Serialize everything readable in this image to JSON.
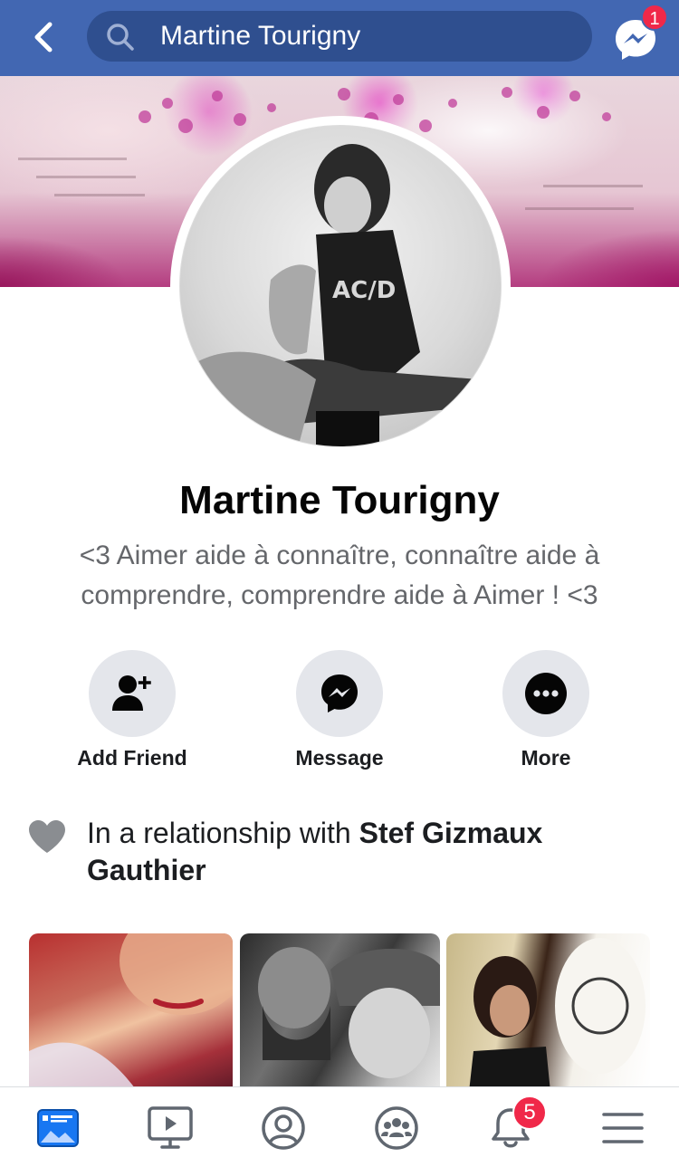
{
  "header": {
    "search_value": "Martine Tourigny",
    "messenger_badge": "1",
    "icons": [
      "back-arrow-icon",
      "search-icon",
      "messenger-icon"
    ]
  },
  "profile": {
    "name": "Martine Tourigny",
    "bio": "<3 Aimer aide à connaître, connaître aide à comprendre, comprendre aide à Aimer ! <3"
  },
  "actions": [
    {
      "label": "Add Friend",
      "icon": "add-friend-icon"
    },
    {
      "label": "Message",
      "icon": "messenger-icon"
    },
    {
      "label": "More",
      "icon": "more-dots-icon"
    }
  ],
  "relationship": {
    "prefix": "In a relationship with ",
    "partner": "Stef Gizmaux Gauthier",
    "icon": "heart-icon"
  },
  "tabbar": {
    "tabs": [
      "news-feed-icon",
      "watch-icon",
      "profile-icon",
      "groups-icon",
      "notifications-icon",
      "menu-icon"
    ],
    "notifications_badge": "5"
  },
  "colors": {
    "brand_blue": "#4267b2",
    "search_bg": "#2f4f8f",
    "badge_red": "#f02849",
    "active_tab": "#1877f2",
    "muted_text": "#65676b"
  }
}
